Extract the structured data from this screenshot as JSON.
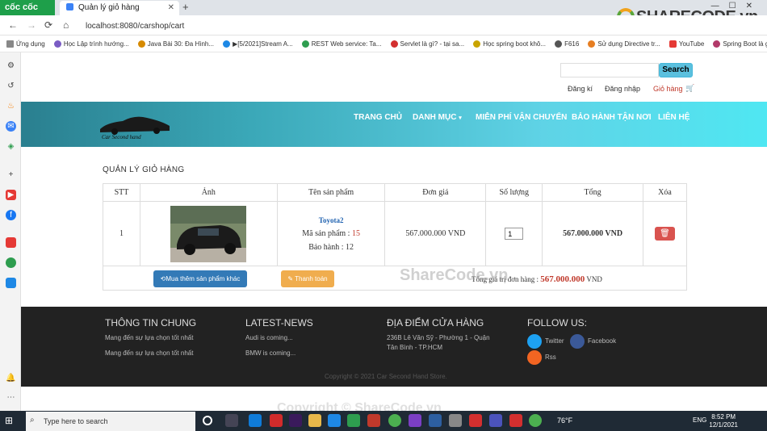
{
  "browser": {
    "brand": "cốc cốc",
    "tab_title": "Quản lý giỏ hàng",
    "url": "localhost:8080/carshop/cart",
    "bookmarks": [
      "Ứng dụng",
      "Học Lập trình hướng...",
      "Java Bài 30: Đa Hình...",
      "▶[5/2021]Stream A...",
      "REST Web service: Ta...",
      "Servlet là gì? - tại sa...",
      "Học spring boot khô...",
      "F616",
      "Sử dụng Directive tr...",
      "YouTube",
      "Spring Boot là gì? Ba..."
    ]
  },
  "watermark": {
    "logo": "SHARECODE.vn",
    "center": "ShareCode.vn",
    "bottom": "Copyright © ShareCode.vn"
  },
  "header": {
    "search_placeholder": "",
    "search_button": "Search",
    "register": "Đăng kí",
    "login": "Đăng nhập",
    "cart": "Giỏ hàng"
  },
  "nav": {
    "logo_text": "Car Second hand",
    "items": [
      "TRANG CHỦ",
      "DANH MỤC",
      "MIỄN PHÍ VẬN CHUYỂN",
      "BẢO HÀNH TẬN NƠI",
      "LIÊN HỆ"
    ]
  },
  "cart": {
    "title": "QUẢN LÝ GIỎ HÀNG",
    "columns": [
      "STT",
      "Ảnh",
      "Tên sản phẩm",
      "Đơn giá",
      "Số lượng",
      "Tổng",
      "Xóa"
    ],
    "row": {
      "stt": "1",
      "name": "Toyota2",
      "code_label": "Mã sản phẩm : ",
      "code": "15",
      "warranty": "Bảo hành : 12",
      "price": "567.000.000 VND",
      "qty": "1",
      "total": "567.000.000 VND"
    },
    "more_button": "Mua thêm sản phẩm khác",
    "pay_button": "Thanh toán",
    "total_label": "Tổng giá trị đơn hàng : ",
    "total_value": "567.000.000",
    "total_unit": " VND"
  },
  "footer": {
    "col1": {
      "title": "THÔNG TIN CHUNG",
      "lines": [
        "Mang đến sự lựa chọn tốt nhất",
        "Mang đến sự lựa chọn tốt nhất"
      ]
    },
    "col2": {
      "title": "LATEST-NEWS",
      "lines": [
        "Audi is coming...",
        "BMW is coming..."
      ]
    },
    "col3": {
      "title": "ĐỊA ĐIỂM CỬA HÀNG",
      "lines": [
        "236B Lê Văn Sỹ - Phường 1 - Quận",
        "Tân Bình - TP.HCM"
      ]
    },
    "col4": {
      "title": "FOLLOW US:",
      "twitter": "Twitter",
      "facebook": "Facebook",
      "rss": "Rss"
    },
    "copyright": "Copyright © 2021 Car Second Hand Store."
  },
  "taskbar": {
    "search": "Type here to search",
    "temp": "76°F",
    "lang": "ENG",
    "time": "8:52 PM",
    "date": "12/1/2021"
  }
}
